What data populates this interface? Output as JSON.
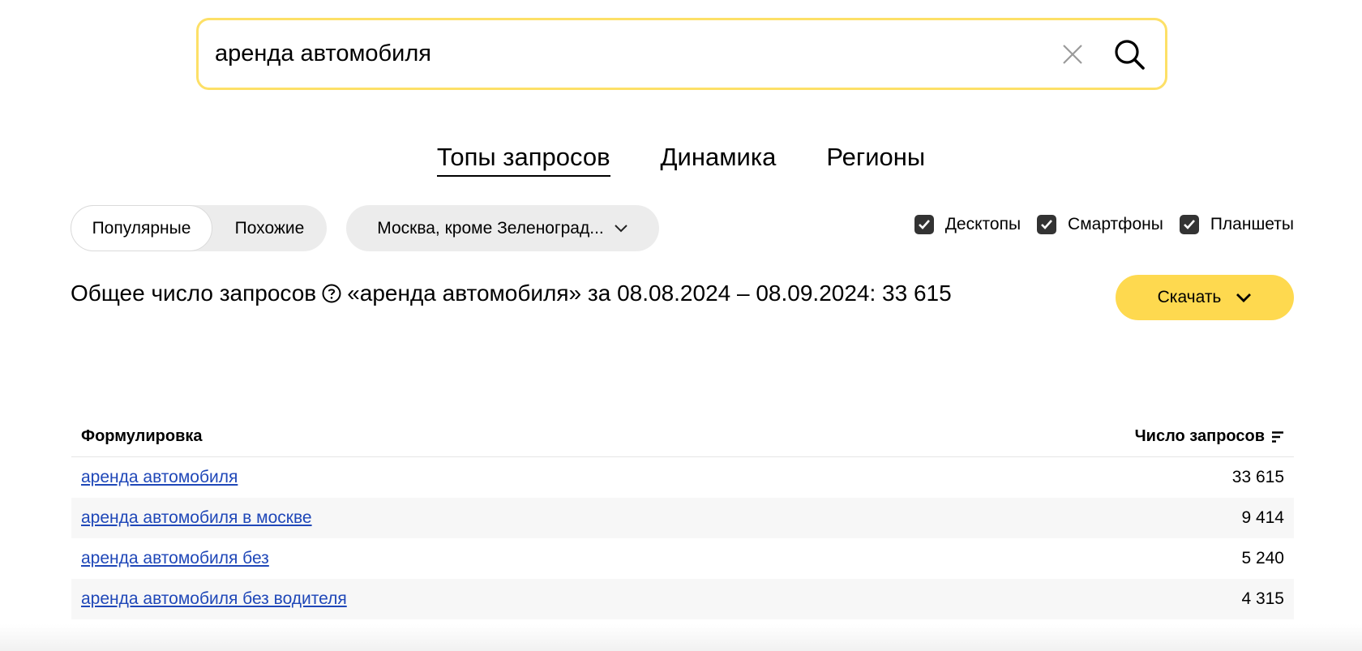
{
  "search": {
    "value": "аренда автомобиля"
  },
  "tabs": [
    {
      "label": "Топы запросов",
      "active": true
    },
    {
      "label": "Динамика",
      "active": false
    },
    {
      "label": "Регионы",
      "active": false
    }
  ],
  "segments": [
    {
      "label": "Популярные",
      "active": true
    },
    {
      "label": "Похожие",
      "active": false
    }
  ],
  "region": {
    "label": "Москва, кроме Зеленоград..."
  },
  "devices": [
    {
      "label": "Десктопы",
      "checked": true
    },
    {
      "label": "Смартфоны",
      "checked": true
    },
    {
      "label": "Планшеты",
      "checked": true
    }
  ],
  "summary": {
    "prefix": "Общее число запросов",
    "details": "«аренда автомобиля» за 08.08.2024 – 08.09.2024: 33 615"
  },
  "download": {
    "label": "Скачать"
  },
  "table": {
    "headers": {
      "phrase": "Формулировка",
      "count": "Число запросов"
    },
    "rows": [
      {
        "phrase": "аренда автомобиля",
        "count": "33 615"
      },
      {
        "phrase": "аренда автомобиля в москве",
        "count": "9 414"
      },
      {
        "phrase": "аренда автомобиля без",
        "count": "5 240"
      },
      {
        "phrase": "аренда автомобиля без водителя",
        "count": "4 315"
      }
    ]
  },
  "colors": {
    "search_border": "#fde067",
    "download_bg": "#fed94f",
    "link": "#1f47b8",
    "chip_bg": "#ececec"
  },
  "icons": {
    "clear": "close-icon",
    "search": "search-icon",
    "region": "chevron-down-icon",
    "help": "help-icon",
    "download": "chevron-down-icon",
    "sort": "sort-icon",
    "check": "checkmark-icon"
  }
}
